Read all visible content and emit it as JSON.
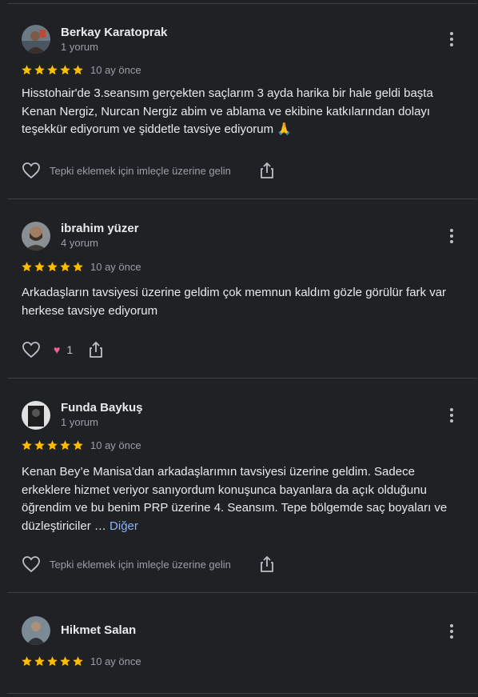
{
  "reviews": [
    {
      "name": "Berkay Karatoprak",
      "count": "1 yorum",
      "rating": 5,
      "time": "10 ay önce",
      "text": "Hisstohair'de 3.seansım gerçekten saçlarım 3 ayda harika bir hale geldi başta Kenan Nergiz, Nurcan Nergiz abim ve ablama ve ekibine katkılarından dolayı teşekkür ediyorum ve şiddetle tavsiye ediyorum 🙏",
      "react_hint": "Tepki eklemek için imleçle üzerine gelin"
    },
    {
      "name": "ibrahim yüzer",
      "count": "4 yorum",
      "rating": 5,
      "time": "10 ay önce",
      "text": "Arkadaşların tavsiyesi üzerine geldim çok memnun kaldım gözle görülür fark var herkese tavsiye ediyorum",
      "reaction_count": "1"
    },
    {
      "name": "Funda Baykuş",
      "count": "1 yorum",
      "rating": 5,
      "time": "10 ay önce",
      "text": "Kenan Bey’e Manisa’dan arkadaşlarımın tavsiyesi üzerine geldim. Sadece erkeklere hizmet veriyor sanıyordum konuşunca bayanlara da açık olduğunu öğrendim ve bu benim PRP üzerine 4. Seansım. Tepe bölgemde saç boyaları ve düzleştiriciler …",
      "more_label": "Diğer",
      "react_hint": "Tepki eklemek için imleçle üzerine gelin"
    },
    {
      "name": "Hikmet Salan",
      "rating": 5,
      "time": "10 ay önce"
    }
  ],
  "colors": {
    "background": "#202124",
    "star": "#fbbc04",
    "link": "#8ab4f8",
    "reaction": "#f06292"
  },
  "icons": [
    "more-vert-icon",
    "star-icon",
    "heart-outline-icon",
    "share-icon",
    "heart-reaction-icon"
  ]
}
